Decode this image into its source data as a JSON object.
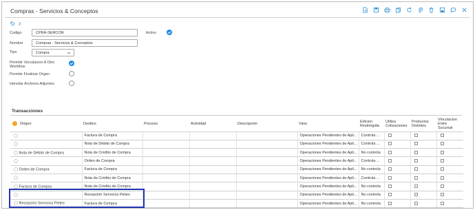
{
  "header": {
    "title": "Compras - Servicios & Conceptos",
    "toolbar_icons": [
      "new-document-icon",
      "save-icon",
      "print-icon",
      "copy-icon",
      "refresh-icon",
      "attach-icon",
      "delete-icon",
      "save-close-icon",
      "comment-icon",
      "close-icon"
    ]
  },
  "breadcrumb": {
    "icons": [
      "tag-icon",
      "chevron-right-icon"
    ]
  },
  "form": {
    "codigo_label": "Codigo",
    "codigo_value": "CPRA-SERCON",
    "nombre_label": "Nombre",
    "nombre_value": "Compras - Servicios & Conceptos",
    "activo_label": "Activo",
    "activo_checked": true,
    "tipo_label": "Tipo",
    "tipo_value": "Compra",
    "permitir_vinculacion_label_1": "Permitir Vinculacion A Otro",
    "permitir_vinculacion_label_2": "Workflow",
    "permitir_vinculacion_checked": true,
    "permite_finalizar_label": "Permite Finalizar Orgen",
    "permite_finalizar_checked": false,
    "heredar_archivos_label": "Heredar Archivos Adjuntos",
    "heredar_archivos_checked": false
  },
  "transacciones": {
    "title": "Transacciones",
    "columns": {
      "origen": "Origen",
      "destino": "Destino",
      "proceso": "Proceso",
      "actividad": "Actividad",
      "descripcion": "Descripción",
      "view": "View",
      "edicion_1": "Edicion",
      "edicion_2": "Restringida",
      "utiliza_1": "Utiliza",
      "utiliza_2": "Cotizaciones",
      "productos_1": "Productos",
      "productos_2": "Distintos",
      "vinculacion_1": "Vinculacion",
      "vinculacion_2": "Entre",
      "vinculacion_3": "Sucursal"
    },
    "rows": [
      {
        "origen": "",
        "destino": "Factura de Compra",
        "proceso": "",
        "actividad": "",
        "descripcion": "",
        "view": "Operaciones Pendientes de Apli...",
        "edicion": "Controla ..."
      },
      {
        "origen": "",
        "destino": "Nota de Débito de Compra",
        "proceso": "",
        "actividad": "",
        "descripcion": "",
        "view": "Operaciones Pendientes de Apli...",
        "edicion": "Controla ..."
      },
      {
        "origen": "Nota de Débito de Compra",
        "destino": "Nota de Crédito de Compra",
        "proceso": "",
        "actividad": "",
        "descripcion": "",
        "view": "Operaciones Pendientes de Apli...",
        "edicion": "No controla"
      },
      {
        "origen": "",
        "destino": "Orden de Compra",
        "proceso": "",
        "actividad": "",
        "descripcion": "",
        "view": "Operaciones Pendientes de Apli...",
        "edicion": "Controla ..."
      },
      {
        "origen": "Orden de Compra",
        "destino": "Factura de Compra",
        "proceso": "",
        "actividad": "",
        "descripcion": "",
        "view": "Operaciones Pendientes de Apli...",
        "edicion": "No controla"
      },
      {
        "origen": "",
        "destino": "Nota de Crédito de Compra",
        "proceso": "",
        "actividad": "",
        "descripcion": "",
        "view": "Operaciones Pendientes de Apli...",
        "edicion": "Controla ..."
      },
      {
        "origen": "Factura de Compra",
        "destino": "Nota de Crédito de Compra",
        "proceso": "",
        "actividad": "",
        "descripcion": "",
        "view": "Operaciones Pendientes de Apli...",
        "edicion": "No controla"
      },
      {
        "origen": "",
        "destino": "Recepción Servicios Fletes",
        "proceso": "",
        "actividad": "",
        "descripcion": "",
        "view": "Operaciones Pendientes de Apli...",
        "edicion": "No controla"
      },
      {
        "origen": "Recepción Servicios Fletes",
        "destino": "Factura de Compra",
        "proceso": "",
        "actividad": "",
        "descripcion": "",
        "view": "Operaciones Pendientes de Apli...",
        "edicion": "No controla"
      }
    ]
  },
  "colors": {
    "accent": "#1e88e5",
    "highlight": "#1f34b0",
    "header_dot": "#f4a62a"
  }
}
